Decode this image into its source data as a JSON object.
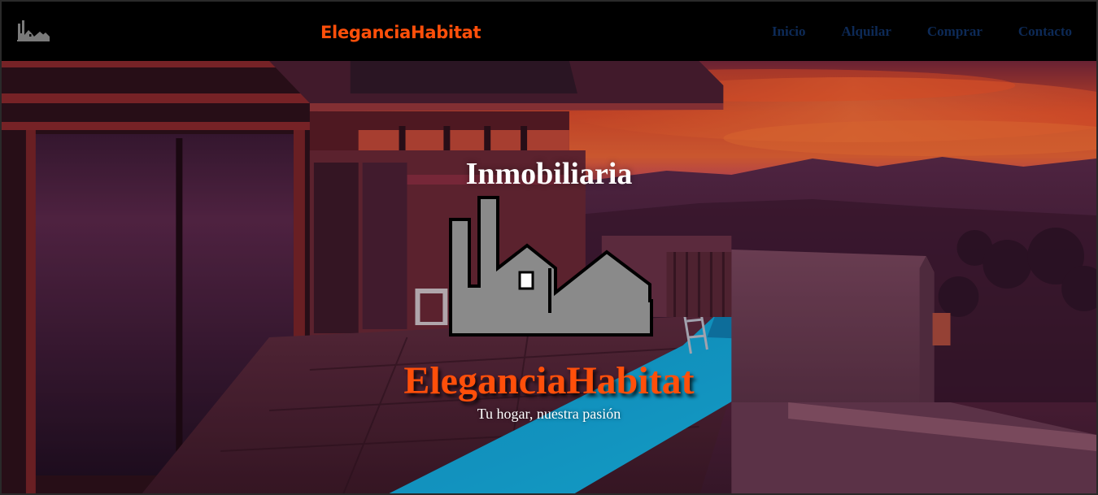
{
  "navbar": {
    "logo_icon": "factory-houses-icon",
    "brand": "EleganciaHabitat",
    "links": [
      {
        "label": "Inicio"
      },
      {
        "label": "Alquilar"
      },
      {
        "label": "Comprar"
      },
      {
        "label": "Contacto"
      }
    ]
  },
  "hero": {
    "heading": "Inmobiliaria",
    "logo_icon": "factory-houses-icon",
    "title": "EleganciaHabitat",
    "tagline": "Tu hogar, nuestra pasión",
    "background": "sunset-modern-house-pool-photo"
  },
  "colors": {
    "brand": "#ff4f0a",
    "nav_link": "#0d2a57",
    "logo_fill": "#8a8a8a",
    "navbar_bg": "#000000"
  }
}
